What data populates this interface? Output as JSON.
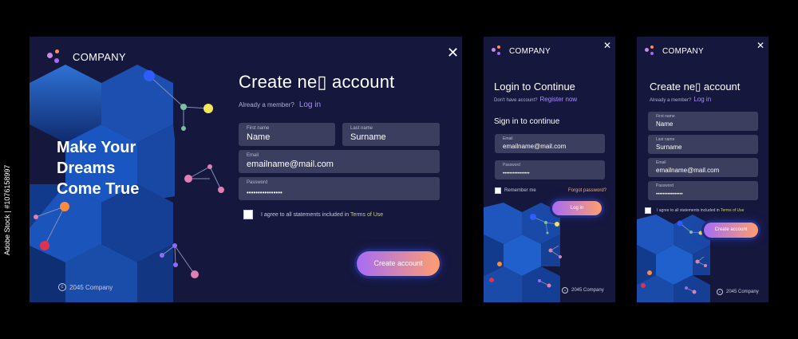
{
  "desktop": {
    "company": "COMPANY",
    "title": "Create ne▯ account",
    "already_member": "Already a member?",
    "login_link": "Log in",
    "first_name_label": "First name",
    "first_name_value": "Name",
    "last_name_label": "Last name",
    "last_name_value": "Surname",
    "email_label": "Email",
    "email_value": "emailname@mail.com",
    "password_label": "Password",
    "password_value": "••••••••••••••••",
    "agree_text": "I agree to all statements included in",
    "terms_link": "Terms of Use",
    "create_button": "Create account",
    "hero_line1": "Make Your",
    "hero_line2": "Dreams",
    "hero_line3": "Come True",
    "copyright": "2045  Company"
  },
  "login_mobile": {
    "company": "COMPANY",
    "title": "Login to Continue",
    "no_account": "Don't have account?",
    "register_link": "Register now",
    "section_title": "Sign in to continue",
    "email_label": "Email",
    "email_value": "emailname@mail.com",
    "password_label": "Password",
    "password_value": "••••••••••••••••",
    "remember": "Remember me",
    "forgot": "Forgot password?",
    "login_button": "Log in",
    "copyright": "2045  Company"
  },
  "signup_mobile": {
    "company": "COMPANY",
    "title": "Create ne▯ account",
    "already_member": "Already a member?",
    "login_link": "Log in",
    "first_name_label": "First name",
    "first_name_value": "Name",
    "last_name_label": "Last name",
    "last_name_value": "Surname",
    "email_label": "Email",
    "email_value": "emailname@mail.com",
    "password_label": "Password",
    "password_value": "••••••••••••••••",
    "agree_text": "I agree to all statements included in",
    "terms_link": "Terms of Use",
    "create_button": "Create account",
    "copyright": "2045  Company"
  },
  "stock_id": "Adobe Stock | #1076158997",
  "colors": {
    "panel_bg": "#15173d",
    "field_bg": "#3b3e5e",
    "accent_link": "#a88cff",
    "button_start": "#a66cf6",
    "button_end": "#ff9d6f",
    "hex_blue": "#1f5fc4"
  }
}
